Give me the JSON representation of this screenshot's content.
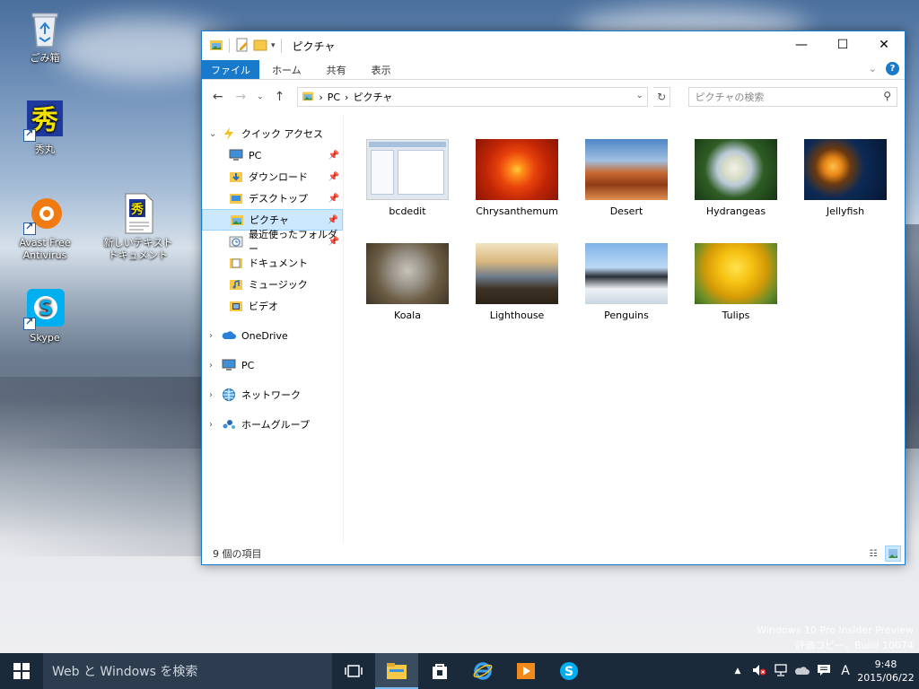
{
  "desktop": {
    "icons": [
      {
        "label": "ごみ箱"
      },
      {
        "label": "秀丸"
      },
      {
        "label": "Avast Free Antivirus"
      },
      {
        "label": "新しいテキスト ドキュメント"
      },
      {
        "label": "Skype"
      }
    ],
    "watermark": {
      "line1": "Windows 10 Pro Insider Preview",
      "line2": "評価コピー。Build 10074"
    }
  },
  "explorer": {
    "title": "ピクチャ",
    "ribbon_tabs": [
      {
        "label": "ファイル"
      },
      {
        "label": "ホーム"
      },
      {
        "label": "共有"
      },
      {
        "label": "表示"
      }
    ],
    "breadcrumb": [
      "PC",
      "ピクチャ"
    ],
    "search_placeholder": "ピクチャの検索",
    "nav": {
      "quick_access": "クイック アクセス",
      "quick_items": [
        {
          "label": "PC",
          "icon": "pc-icon"
        },
        {
          "label": "ダウンロード",
          "icon": "download-folder-icon"
        },
        {
          "label": "デスクトップ",
          "icon": "desktop-folder-icon"
        },
        {
          "label": "ピクチャ",
          "icon": "pictures-folder-icon"
        },
        {
          "label": "最近使ったフォルダー",
          "icon": "recent-folder-icon"
        },
        {
          "label": "ドキュメント",
          "icon": "documents-folder-icon"
        },
        {
          "label": "ミュージック",
          "icon": "music-folder-icon"
        },
        {
          "label": "ビデオ",
          "icon": "video-folder-icon"
        }
      ],
      "roots": [
        {
          "label": "OneDrive",
          "icon": "onedrive-icon"
        },
        {
          "label": "PC",
          "icon": "pc-icon"
        },
        {
          "label": "ネットワーク",
          "icon": "network-icon"
        },
        {
          "label": "ホームグループ",
          "icon": "homegroup-icon"
        }
      ]
    },
    "files": [
      {
        "name": "bcdedit"
      },
      {
        "name": "Chrysanthemum"
      },
      {
        "name": "Desert"
      },
      {
        "name": "Hydrangeas"
      },
      {
        "name": "Jellyfish"
      },
      {
        "name": "Koala"
      },
      {
        "name": "Lighthouse"
      },
      {
        "name": "Penguins"
      },
      {
        "name": "Tulips"
      }
    ],
    "status": "9 個の項目"
  },
  "taskbar": {
    "search_placeholder": "Web と Windows を検索",
    "ime": "A",
    "time": "9:48",
    "date": "2015/06/22"
  },
  "colors": {
    "accent": "#1979ca",
    "selection": "#cce8ff",
    "taskbar": "#1b2a3b"
  }
}
